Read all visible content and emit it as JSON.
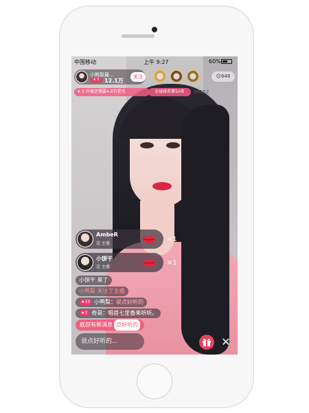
{
  "status": {
    "carrier": "中国移动",
    "time": "上午 9:27",
    "battery": "60%",
    "battery_level": 0.6
  },
  "host": {
    "name": "小鸭梨最...",
    "level": "★ 5",
    "followers": "12.1万",
    "follow_label": "关注"
  },
  "viewers": {
    "count": "648",
    "avatars": [
      "viewer-1",
      "viewer-2",
      "viewer-3"
    ]
  },
  "badges": {
    "level": "★ 5",
    "upgrade": "升级还需要4.8万星光",
    "rank": "全球排名第50名",
    "room_id": "89352"
  },
  "gifts": [
    {
      "name": "AmbeR",
      "action": "送 主播",
      "count": "×1"
    },
    {
      "name": "小饼干",
      "action": "送 主播",
      "count": "×1"
    }
  ],
  "chat": {
    "line1": "小饼干 来了",
    "line2": "小鸭梨 关注了主播",
    "line3_level": "★10",
    "line3_user": "小鸭梨：",
    "line3_msg": "说点好听的",
    "line4_level": "★3",
    "line4_user": "奇哥：",
    "line4_msg": "唱首七里香来听听。"
  },
  "new_message": {
    "text": "底部有新消息",
    "tail": "点好听的"
  },
  "input": {
    "placeholder": "说点好听的..."
  },
  "colors": {
    "accent": "#ec3b6c",
    "gift_button": "#e8415f"
  }
}
